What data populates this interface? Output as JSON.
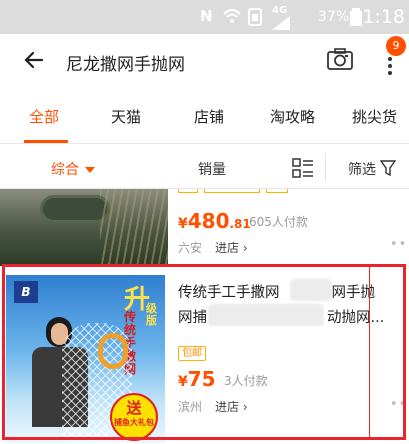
{
  "status_bar": {
    "carrier_icon": "nfc-n-icon",
    "network": "4G",
    "battery": "37%",
    "time": "21:18"
  },
  "header": {
    "query": "尼龙撒网手抛网",
    "badge_count": "9"
  },
  "tabs": [
    {
      "label": "全部",
      "active": true
    },
    {
      "label": "天猫",
      "active": false
    },
    {
      "label": "店铺",
      "active": false
    },
    {
      "label": "淘攻略",
      "active": false
    },
    {
      "label": "挑尖货",
      "active": false
    }
  ],
  "sortbar": {
    "comprehensive": "综合",
    "sales": "销量",
    "filter": "筛选"
  },
  "products": [
    {
      "price_currency": "¥",
      "price_int": "480",
      "price_dec": ".81",
      "paid": "605人付款",
      "location": "六安",
      "store_link": "进店"
    },
    {
      "title": "传统手工手撒网",
      "title_mid": "网手抛",
      "title_line2_a": "网捕",
      "title_line2_b": "动抛网...",
      "tag": "包邮",
      "price_currency": "¥",
      "price_int": "75",
      "paid": "3人付款",
      "location": "滨州",
      "store_link": "进店",
      "image": {
        "logo": "B",
        "upgrade": "升",
        "upgrade_sub": "级版",
        "vertical": "传统手撒网",
        "badge_big": "送",
        "badge_small": "捕鱼大礼包"
      }
    }
  ],
  "colors": {
    "accent": "#ff5000",
    "highlight": "#e8252f"
  }
}
